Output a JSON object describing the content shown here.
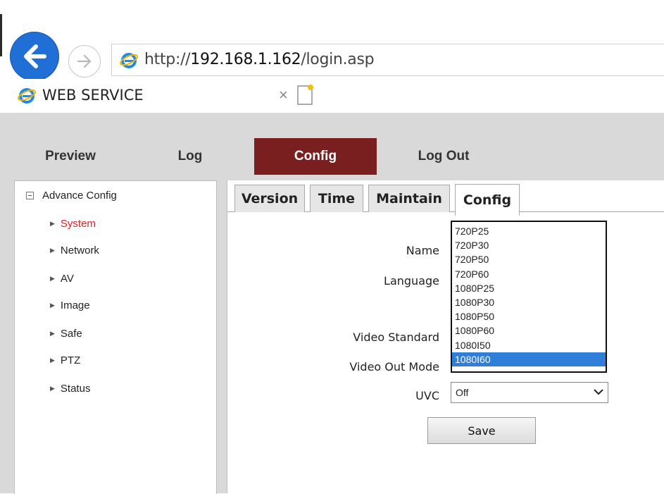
{
  "browser": {
    "url_prefix": "http://",
    "url_host": "192.168.1.162",
    "url_path": "/login.asp",
    "tab_title": "WEB SERVICE",
    "tab_close": "×"
  },
  "nav": {
    "items": [
      {
        "label": "Preview"
      },
      {
        "label": "Log"
      },
      {
        "label": "Config"
      },
      {
        "label": "Log Out"
      }
    ],
    "active": "Config",
    "active_color": "#7a1f1f"
  },
  "sidebar": {
    "root": "Advance Config",
    "items": [
      {
        "label": "System"
      },
      {
        "label": "Network"
      },
      {
        "label": "AV"
      },
      {
        "label": "Image"
      },
      {
        "label": "Safe"
      },
      {
        "label": "PTZ"
      },
      {
        "label": "Status"
      }
    ],
    "active_color": "#e02020"
  },
  "subtabs": [
    {
      "label": "Version"
    },
    {
      "label": "Time"
    },
    {
      "label": "Maintain"
    },
    {
      "label": "Config"
    }
  ],
  "form": {
    "name_label": "Name",
    "language_label": "Language",
    "video_standard_label": "Video Standard",
    "video_out_mode_label": "Video Out Mode",
    "uvc_label": "UVC",
    "uvc_value": "Off",
    "save_label": "Save"
  },
  "dropdown": {
    "options": [
      "720P25",
      "720P30",
      "720P50",
      "720P60",
      "1080P25",
      "1080P30",
      "1080P50",
      "1080P60",
      "1080I50",
      "1080I60"
    ],
    "selected": "1080I60",
    "selected_color": "#2f7ed8"
  }
}
